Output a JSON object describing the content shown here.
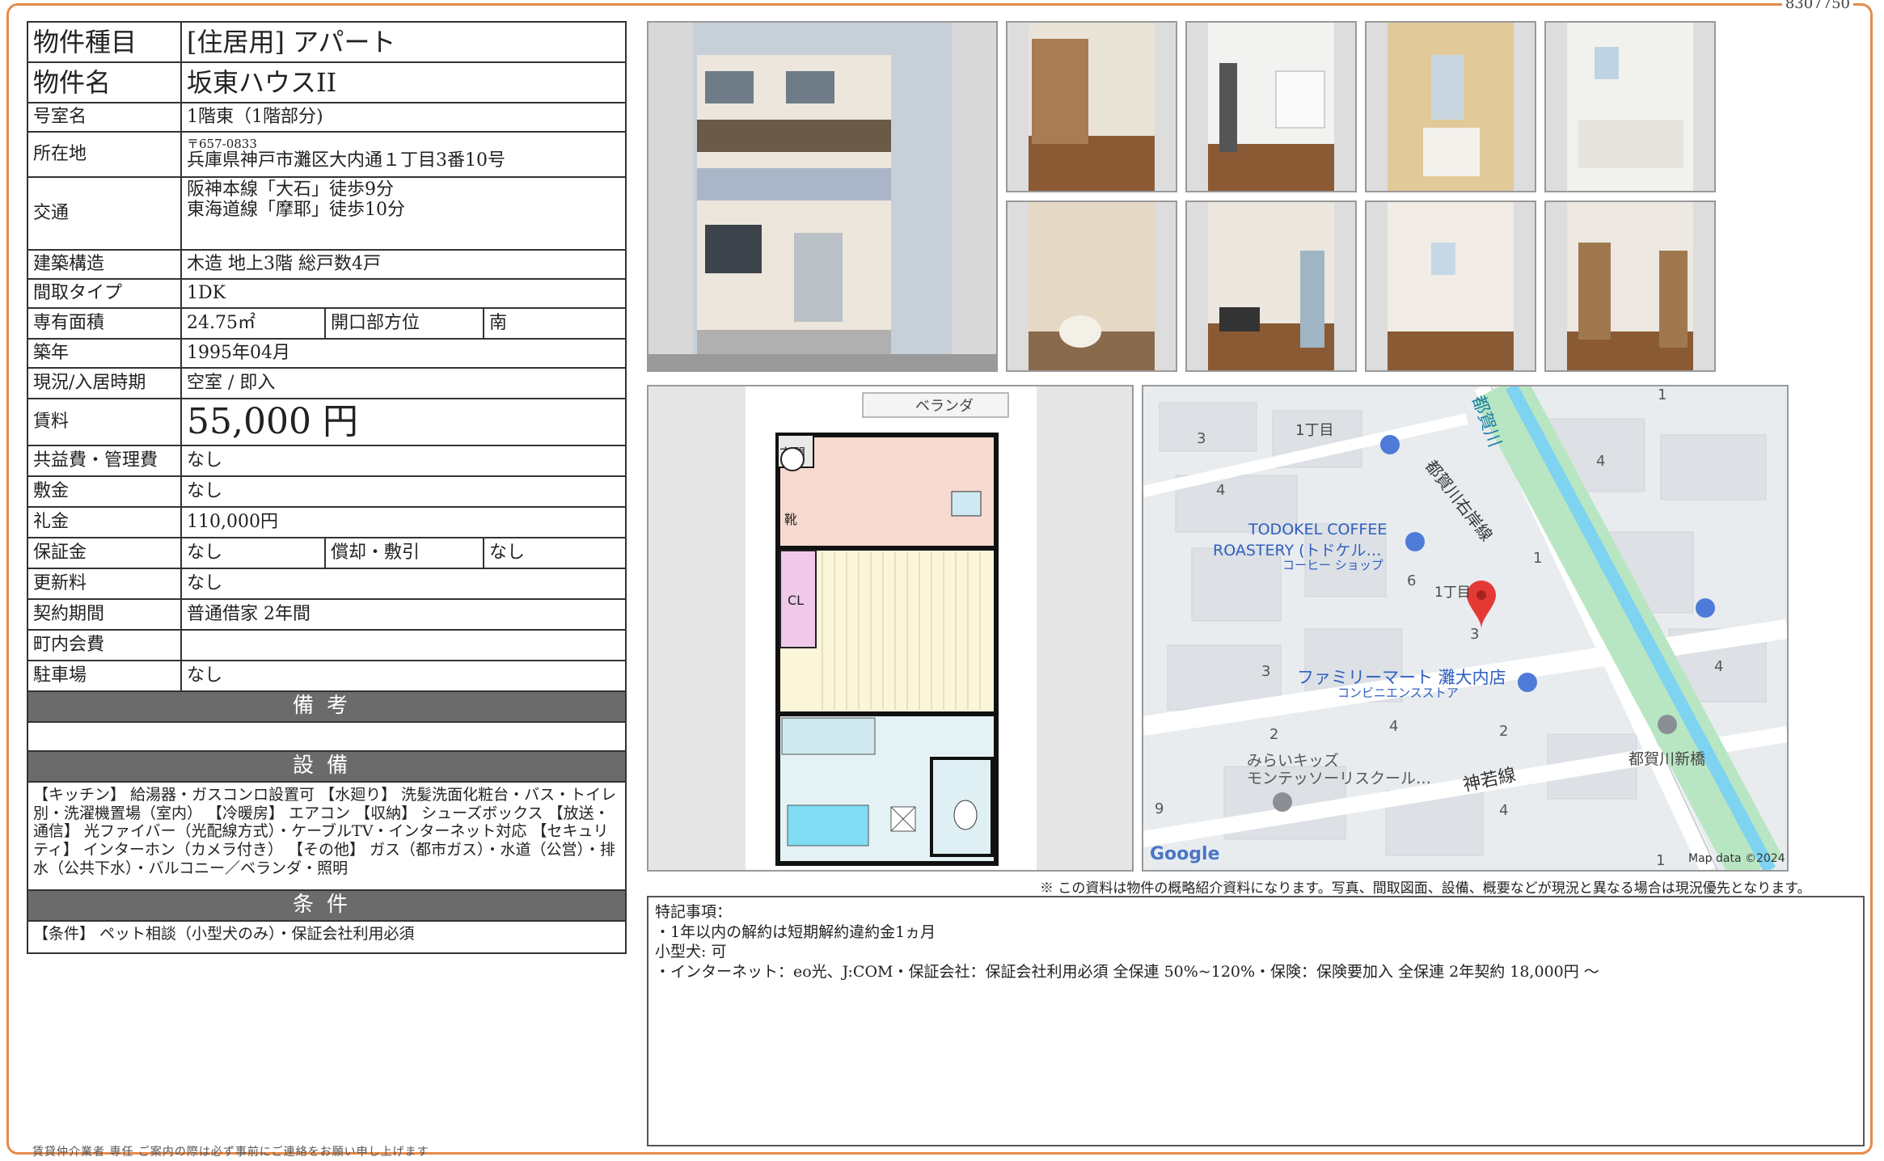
{
  "doc_no": "8307750",
  "spec": {
    "type_label": "物件種目",
    "type_value": "[住居用] アパート",
    "name_label": "物件名",
    "name_value": "坂東ハウスII",
    "room_label": "号室名",
    "room_value": "1階東（1階部分)",
    "addr_label": "所在地",
    "addr_zip": "〒657-0833",
    "addr_value": "兵庫県神戸市灘区大内通１丁目3番10号",
    "access_label": "交通",
    "access_1": "阪神本線「大石」徒歩9分",
    "access_2": "東海道線「摩耶」徒歩10分",
    "struct_label": "建築構造",
    "struct_value": "木造 地上3階 総戸数4戸",
    "layout_label": "間取タイプ",
    "layout_value": "1DK",
    "area_label": "専有面積",
    "area_value": "24.75㎡",
    "dir_label": "開口部方位",
    "dir_value": "南",
    "built_label": "築年",
    "built_value": "1995年04月",
    "status_label": "現況/入居時期",
    "status_value": "空室 / 即入",
    "rent_label": "賃料",
    "rent_value": "55,000 円",
    "fee_label": "共益費・管理費",
    "fee_value": "なし",
    "deposit_label": "敷金",
    "deposit_value": "なし",
    "key_label": "礼金",
    "key_value": "110,000円",
    "guar_label": "保証金",
    "guar_value": "なし",
    "amort_label": "償却・敷引",
    "amort_value": "なし",
    "renew_label": "更新料",
    "renew_value": "なし",
    "term_label": "契約期間",
    "term_value": "普通借家 2年間",
    "town_label": "町内会費",
    "town_value": "",
    "park_label": "駐車場",
    "park_value": "なし",
    "remarks_header": "備考",
    "equip_header": "設備",
    "equip_text": "【キッチン】 給湯器・ガスコンロ設置可 【水廻り】 洗髪洗面化粧台・バス・トイレ別・洗濯機置場（室内） 【冷暖房】 エアコン 【収納】 シューズボックス 【放送・通信】 光ファイバー（光配線方式）・ケーブルTV・インターネット対応 【セキュリティ】 インターホン（カメラ付き） 【その他】 ガス（都市ガス）・水道（公営）・排水（公共下水）・バルコニー／ベランダ・照明",
    "cond_header": "条件",
    "cond_text": "【条件】 ペット相談（小型犬のみ）・保証会社利用必須"
  },
  "floorplan": {
    "veranda": "ベランダ",
    "entrance": "玄関",
    "shoes": "靴",
    "closet": "CL"
  },
  "map": {
    "labels": [
      "都賀川",
      "1丁目",
      "TODOKEL COFFEE",
      "ROASTERY (トドケル…",
      "コーヒー ショップ",
      "都賀川右岸線",
      "ファミリーマート 灘大内店",
      "コンビニエンスストア",
      "みらいキッズ",
      "モンテッソーリスクール…",
      "神若線",
      "都賀川新橋",
      "Google",
      "Map data ©2024",
      "1丁目"
    ],
    "numbers": [
      "1",
      "3",
      "4",
      "4",
      "1",
      "6",
      "3",
      "3",
      "4",
      "2",
      "4",
      "2",
      "9",
      "4",
      "1",
      "3"
    ]
  },
  "note": "※ この資料は物件の概略紹介資料になります。写真、間取図面、設備、概要などが現況と異なる場合は現況優先となります。",
  "remarks": {
    "line1": "特記事項：",
    "line2": "・1年以内の解約は短期解約違約金1ヵ月",
    "line3": "小型犬: 可",
    "line4": "・インターネット：eo光、J:COM・保証会社：保証会社利用必須 全保連 50%~120%・保険：保険要加入 全保連 2年契約 18,000円 ～"
  },
  "footer": "賃貸仲介業者 専任 ご案内の際は必ず事前にご連絡をお願い申し上げます"
}
